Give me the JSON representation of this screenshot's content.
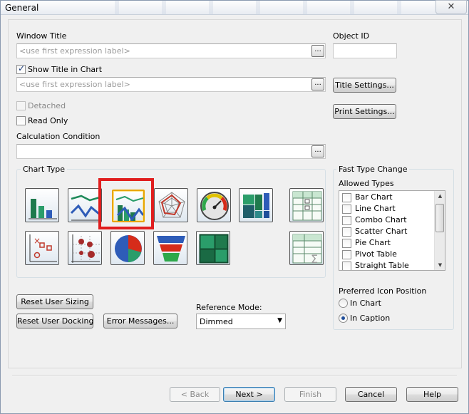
{
  "window": {
    "title": "General",
    "close_label": "✕"
  },
  "window_title": {
    "label": "Window Title",
    "placeholder": "<use first expression label>"
  },
  "object_id": {
    "label": "Object ID",
    "value": ""
  },
  "show_title": {
    "label": "Show Title in Chart",
    "checked": true,
    "placeholder": "<use first expression label>"
  },
  "buttons": {
    "title_settings": "Title Settings...",
    "print_settings": "Print Settings...",
    "dots": "...",
    "reset_user_sizing": "Reset User Sizing",
    "reset_user_docking": "Reset User Docking",
    "error_messages": "Error Messages...",
    "back": "< Back",
    "next": "Next >",
    "finish": "Finish",
    "cancel": "Cancel",
    "help": "Help"
  },
  "detached": {
    "label": "Detached"
  },
  "read_only": {
    "label": "Read Only"
  },
  "calculation_condition": {
    "label": "Calculation Condition",
    "value": ""
  },
  "chart_type": {
    "label": "Chart Type",
    "icons": [
      "bar-chart-icon",
      "line-chart-icon",
      "combo-chart-icon",
      "radar-chart-icon",
      "gauge-chart-icon",
      "mekko-chart-icon",
      "pivot-table-icon",
      "scatter-chart-icon",
      "grid-chart-icon",
      "pie-chart-icon",
      "funnel-chart-icon",
      "block-chart-icon",
      "straight-table-icon"
    ],
    "selected": "combo-chart-icon"
  },
  "fast_type_change": {
    "label": "Fast Type Change",
    "allowed_types_label": "Allowed Types",
    "types": [
      "Bar Chart",
      "Line Chart",
      "Combo Chart",
      "Scatter Chart",
      "Pie Chart",
      "Pivot Table",
      "Straight Table"
    ],
    "preferred_icon_position_label": "Preferred Icon Position",
    "positions": [
      "In Chart",
      "In Caption"
    ],
    "selected_position": "In Caption"
  },
  "reference_mode": {
    "label": "Reference Mode:",
    "value": "Dimmed"
  },
  "colors": {
    "highlight": "#e01e1e",
    "selected_border": "#e8a500"
  }
}
